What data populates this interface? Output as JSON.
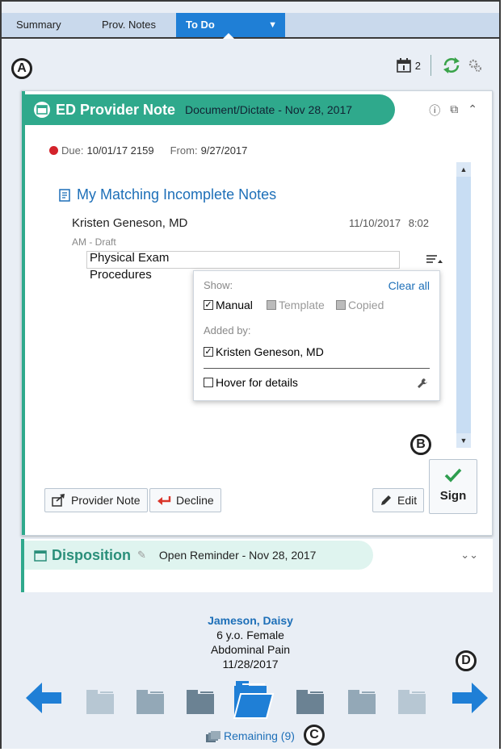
{
  "tabs": [
    {
      "label": "Summary"
    },
    {
      "label": "Prov. Notes"
    },
    {
      "label": "To Do"
    }
  ],
  "toolbar": {
    "calendar_count": "2"
  },
  "callouts": {
    "a": "A",
    "b": "B",
    "c": "C",
    "d": "D"
  },
  "note_card": {
    "title": "ED Provider Note",
    "subtitle": "Document/Dictate - Nov 28, 2017",
    "due_label": "Due:",
    "due_value": "10/01/17 2159",
    "from_label": "From:",
    "from_value": "9/27/2017",
    "section_title": "My Matching Incomplete Notes",
    "author": "Kristen Geneson, MD",
    "date": "11/10/2017",
    "time": "8:02",
    "status": "AM - Draft",
    "lines": [
      "Physical Exam",
      "Procedures"
    ],
    "filter": {
      "show_label": "Show:",
      "clear_all": "Clear all",
      "options": [
        {
          "label": "Manual",
          "checked": true
        },
        {
          "label": "Template",
          "checked": false
        },
        {
          "label": "Copied",
          "checked": false
        }
      ],
      "added_by_label": "Added by:",
      "added_by": {
        "label": "Kristen Geneson, MD",
        "checked": true
      },
      "hover_details": {
        "label": "Hover for details",
        "checked": false
      }
    },
    "buttons": {
      "provider_note": "Provider Note",
      "decline": "Decline",
      "edit": "Edit",
      "sign": "Sign"
    }
  },
  "disposition": {
    "title": "Disposition",
    "subtitle": "Open Reminder - Nov 28, 2017"
  },
  "patient": {
    "name": "Jameson, Daisy",
    "age_sex": "6 y.o. Female",
    "complaint": "Abdominal Pain",
    "date": "11/28/2017"
  },
  "remaining": "Remaining (9)",
  "colors": {
    "accent_teal": "#2fa98c",
    "tab_blue": "#1f7fd6",
    "link_blue": "#1d6fb8",
    "due_red": "#d3232b",
    "sign_green": "#2e9e4f"
  }
}
